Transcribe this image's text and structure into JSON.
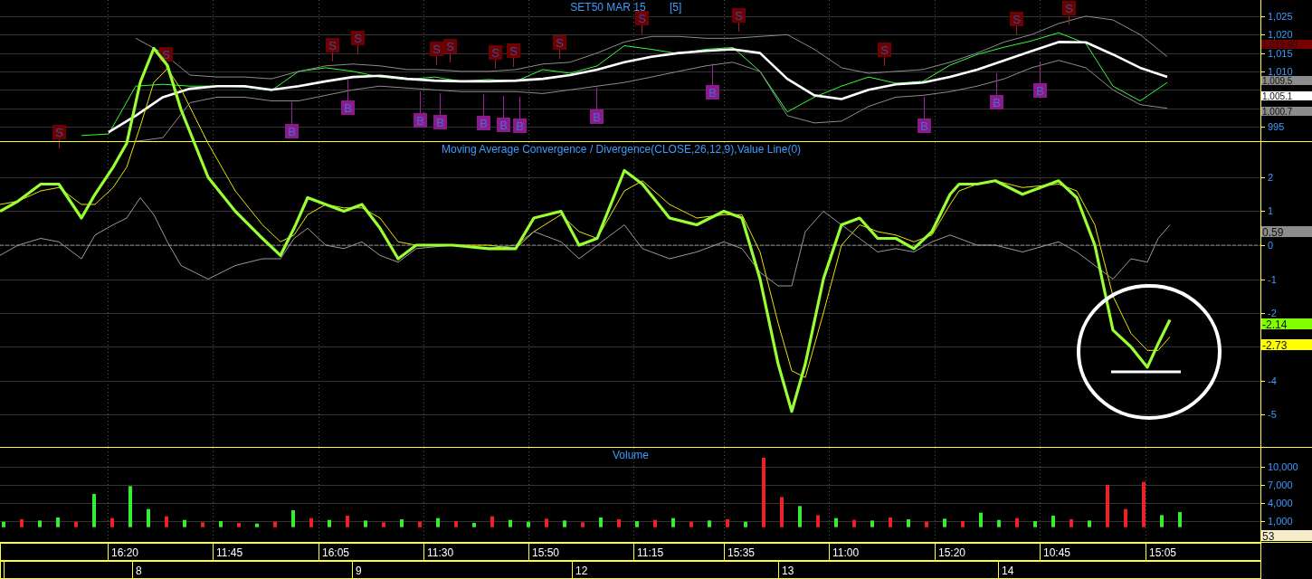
{
  "price_panel": {
    "title": "SET50 MAR 15",
    "interval": "[5]",
    "axis_labels": [
      "1,025",
      "1,020",
      "1,015",
      "1,010",
      "995"
    ],
    "signals": [
      {
        "kind": "sell",
        "label": "S"
      },
      {
        "kind": "sell",
        "label": "S"
      },
      {
        "kind": "sell",
        "label": "S"
      },
      {
        "kind": "sell",
        "label": "S"
      },
      {
        "kind": "sell",
        "label": "S"
      },
      {
        "kind": "sell",
        "label": "S"
      },
      {
        "kind": "sell",
        "label": "S"
      },
      {
        "kind": "sell",
        "label": "S"
      },
      {
        "kind": "sell",
        "label": "S"
      },
      {
        "kind": "sell",
        "label": "S"
      },
      {
        "kind": "sell",
        "label": "S"
      },
      {
        "kind": "sell",
        "label": "S"
      },
      {
        "kind": "sell",
        "label": "S"
      },
      {
        "kind": "sell",
        "label": "S"
      },
      {
        "kind": "buy",
        "label": "B"
      },
      {
        "kind": "buy",
        "label": "B"
      },
      {
        "kind": "buy",
        "label": "B"
      },
      {
        "kind": "buy",
        "label": "B"
      },
      {
        "kind": "buy",
        "label": "B"
      },
      {
        "kind": "buy",
        "label": "B"
      },
      {
        "kind": "buy",
        "label": "B"
      },
      {
        "kind": "buy",
        "label": "B"
      },
      {
        "kind": "buy",
        "label": "B"
      },
      {
        "kind": "buy",
        "label": "B"
      },
      {
        "kind": "buy",
        "label": "B"
      },
      {
        "kind": "buy",
        "label": "B"
      }
    ],
    "tags": [
      {
        "label": "1,019.60",
        "color": "#7a0000"
      },
      {
        "label": "1,009.5",
        "color": "#8c8c8c"
      },
      {
        "label": "1,005.1",
        "color": "#ffffff"
      },
      {
        "label": "1,000.7",
        "color": "#8c8c8c"
      }
    ]
  },
  "macd_panel": {
    "title": "Moving Average Convergence / Divergence(CLOSE,26,12,9),Value Line(0)",
    "axis_labels": [
      "2",
      "1",
      "0",
      "-1",
      "-2",
      "-4",
      "-5"
    ],
    "tags": [
      {
        "label": "0.59",
        "color": "#8c8c8c"
      },
      {
        "label": "-2.14",
        "color": "#80ff00"
      },
      {
        "label": "-2.73",
        "color": "#ffff00"
      }
    ]
  },
  "volume_panel": {
    "title": "Volume",
    "axis_labels": [
      "10,000",
      "7,000",
      "4,000",
      "1,000"
    ],
    "tags": [
      {
        "label": "53",
        "color": "#f5ecc8"
      }
    ]
  },
  "time_axis": {
    "labels": [
      "16:20",
      "11:45",
      "16:05",
      "11:30",
      "15:50",
      "11:15",
      "15:35",
      "11:00",
      "15:20",
      "10:45",
      "15:05"
    ]
  },
  "date_axis": {
    "labels": [
      "8",
      "9",
      "12",
      "13",
      "14"
    ]
  }
}
